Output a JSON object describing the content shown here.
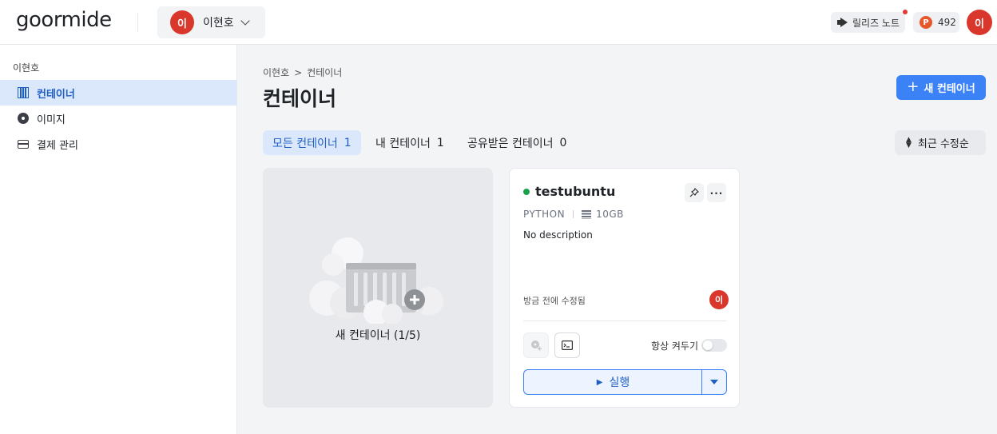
{
  "header": {
    "logo": "goormide",
    "workspace": {
      "avatar_initial": "이",
      "name": "이현호"
    },
    "release_notes": "릴리즈 노트",
    "points": {
      "icon_letter": "P",
      "value": "492"
    },
    "user_avatar_initial": "이"
  },
  "sidebar": {
    "user": "이현호",
    "items": [
      {
        "label": "컨테이너",
        "active": true
      },
      {
        "label": "이미지",
        "active": false
      },
      {
        "label": "결제 관리",
        "active": false
      }
    ]
  },
  "main": {
    "breadcrumb": [
      "이현호",
      "컨테이너"
    ],
    "breadcrumb_separator": ">",
    "title": "컨테이너",
    "new_button": "새 컨테이너",
    "tabs": [
      {
        "label": "모든 컨테이너",
        "count": "1",
        "active": true
      },
      {
        "label": "내 컨테이너",
        "count": "1",
        "active": false
      },
      {
        "label": "공유받은 컨테이너",
        "count": "0",
        "active": false
      }
    ],
    "sort_label": "최근 수정순",
    "new_card_label": "새 컨테이너 (1/5)",
    "container": {
      "name": "testubuntu",
      "status_color": "#16a34a",
      "stack": "PYTHON",
      "disk": "10GB",
      "description": "No description",
      "modified": "방금 전에 수정됨",
      "owner_initial": "이",
      "always_on_label": "항상 켜두기",
      "always_on": false,
      "run_label": "실행"
    }
  },
  "colors": {
    "accent": "#3b82f6",
    "active_bg": "#dbe7fb",
    "avatar": "#d9372c"
  }
}
